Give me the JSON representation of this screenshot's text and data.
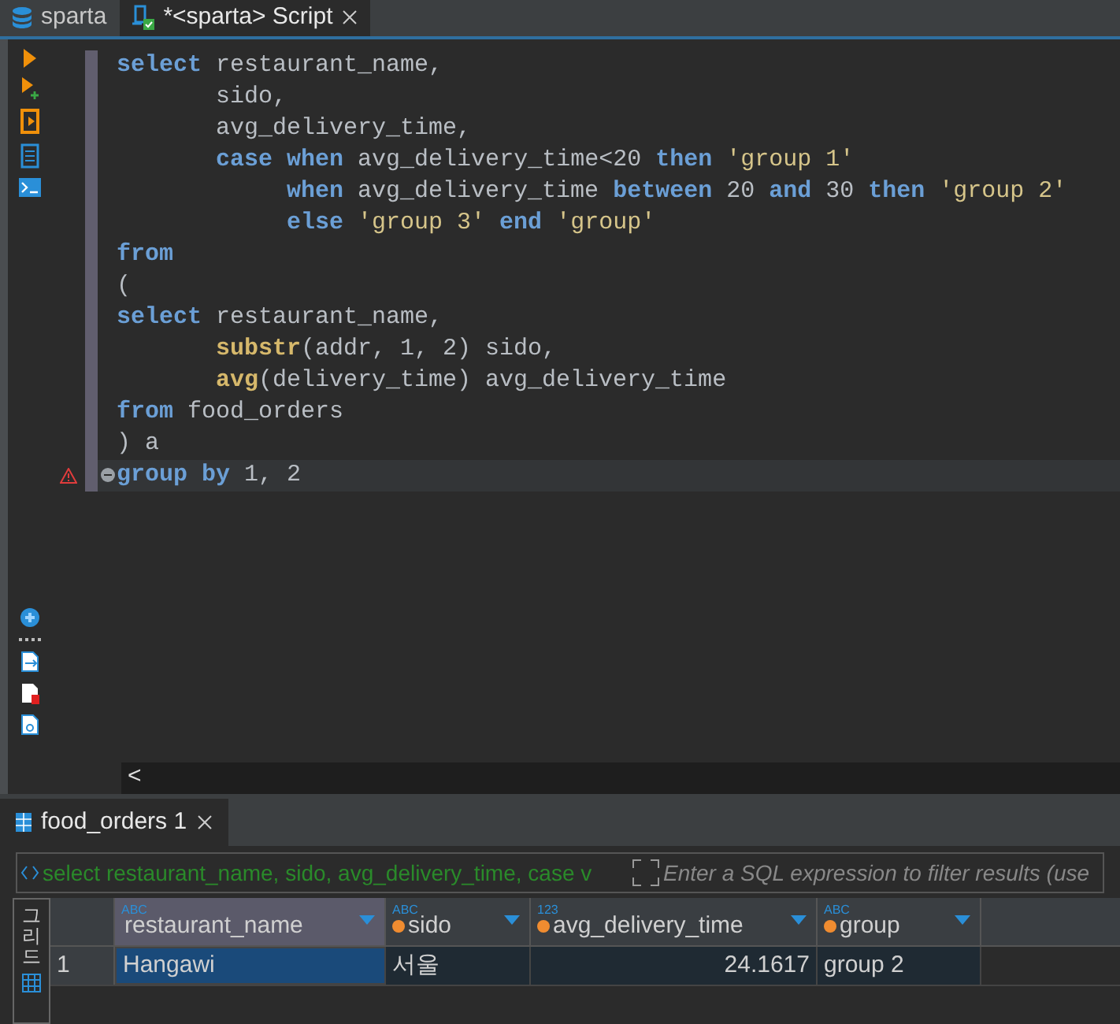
{
  "editor_tabs": [
    {
      "label": "sparta",
      "kind": "database",
      "selected": false
    },
    {
      "label": "*<sparta> Script",
      "kind": "script",
      "selected": true
    }
  ],
  "code_lines": [
    {
      "error": false,
      "current": false,
      "tokens": [
        {
          "kind": "kw",
          "text": "select"
        },
        {
          "kind": "plain",
          "text": " restaurant_name,"
        }
      ]
    },
    {
      "error": false,
      "current": false,
      "tokens": [
        {
          "kind": "plain",
          "text": "       sido,"
        }
      ]
    },
    {
      "error": false,
      "current": false,
      "tokens": [
        {
          "kind": "plain",
          "text": "       avg_delivery_time,"
        }
      ]
    },
    {
      "error": false,
      "current": false,
      "tokens": [
        {
          "kind": "kw",
          "text": "       case"
        },
        {
          "kind": "kw",
          "text": " when"
        },
        {
          "kind": "plain",
          "text": " avg_delivery_time<20 "
        },
        {
          "kind": "kw",
          "text": "then"
        },
        {
          "kind": "str",
          "text": " 'group 1'"
        }
      ]
    },
    {
      "error": false,
      "current": false,
      "tokens": [
        {
          "kind": "kw",
          "text": "            when"
        },
        {
          "kind": "plain",
          "text": " avg_delivery_time "
        },
        {
          "kind": "kw",
          "text": "between"
        },
        {
          "kind": "plain",
          "text": " 20 "
        },
        {
          "kind": "kw",
          "text": "and"
        },
        {
          "kind": "plain",
          "text": " 30 "
        },
        {
          "kind": "kw",
          "text": "then"
        },
        {
          "kind": "str",
          "text": " 'group 2'"
        }
      ]
    },
    {
      "error": false,
      "current": false,
      "tokens": [
        {
          "kind": "kw",
          "text": "            else"
        },
        {
          "kind": "str",
          "text": " 'group 3'"
        },
        {
          "kind": "kw",
          "text": " end"
        },
        {
          "kind": "str",
          "text": " 'group'"
        }
      ]
    },
    {
      "error": false,
      "current": false,
      "tokens": [
        {
          "kind": "kw",
          "text": "from"
        }
      ]
    },
    {
      "error": false,
      "current": false,
      "tokens": [
        {
          "kind": "plain",
          "text": "("
        }
      ]
    },
    {
      "error": false,
      "current": false,
      "tokens": [
        {
          "kind": "kw",
          "text": "select"
        },
        {
          "kind": "plain",
          "text": " restaurant_name,"
        }
      ]
    },
    {
      "error": false,
      "current": false,
      "tokens": [
        {
          "kind": "fn",
          "text": "       substr"
        },
        {
          "kind": "plain",
          "text": "(addr, 1, 2) sido,"
        }
      ]
    },
    {
      "error": false,
      "current": false,
      "tokens": [
        {
          "kind": "fn",
          "text": "       avg"
        },
        {
          "kind": "plain",
          "text": "(delivery_time) avg_delivery_time"
        }
      ]
    },
    {
      "error": false,
      "current": false,
      "tokens": [
        {
          "kind": "kw",
          "text": "from"
        },
        {
          "kind": "plain",
          "text": " food_orders"
        }
      ]
    },
    {
      "error": false,
      "current": false,
      "tokens": [
        {
          "kind": "plain",
          "text": ") a"
        }
      ]
    },
    {
      "error": true,
      "current": true,
      "tokens": [
        {
          "kind": "kw",
          "text": "group"
        },
        {
          "kind": "kw",
          "text": " by"
        },
        {
          "kind": "plain",
          "text": " 1, 2"
        }
      ]
    }
  ],
  "scroll_left": "<",
  "results": {
    "tab": {
      "label": "food_orders 1",
      "selected": true
    },
    "query_text": "select restaurant_name, sido, avg_delivery_time, case v",
    "filter": {
      "placeholder": "Enter a SQL expression to filter results (use"
    },
    "side_tab": "그리드",
    "columns": [
      {
        "name": "restaurant_name",
        "type_label": "ABC",
        "kind": "text",
        "key": false,
        "selected": true
      },
      {
        "name": "sido",
        "type_label": "ABC",
        "kind": "text",
        "key": true,
        "selected": false
      },
      {
        "name": "avg_delivery_time",
        "type_label": "123",
        "kind": "number",
        "key": true,
        "selected": false
      },
      {
        "name": "group",
        "type_label": "ABC",
        "kind": "text",
        "key": true,
        "selected": false
      }
    ],
    "rows": [
      {
        "number": "1",
        "cells": [
          {
            "text": "Hangawi",
            "selected": true
          },
          {
            "text": "서울",
            "selected": false
          },
          {
            "text": "24.1617",
            "selected": false
          },
          {
            "text": "group 2",
            "selected": false
          }
        ]
      }
    ]
  }
}
